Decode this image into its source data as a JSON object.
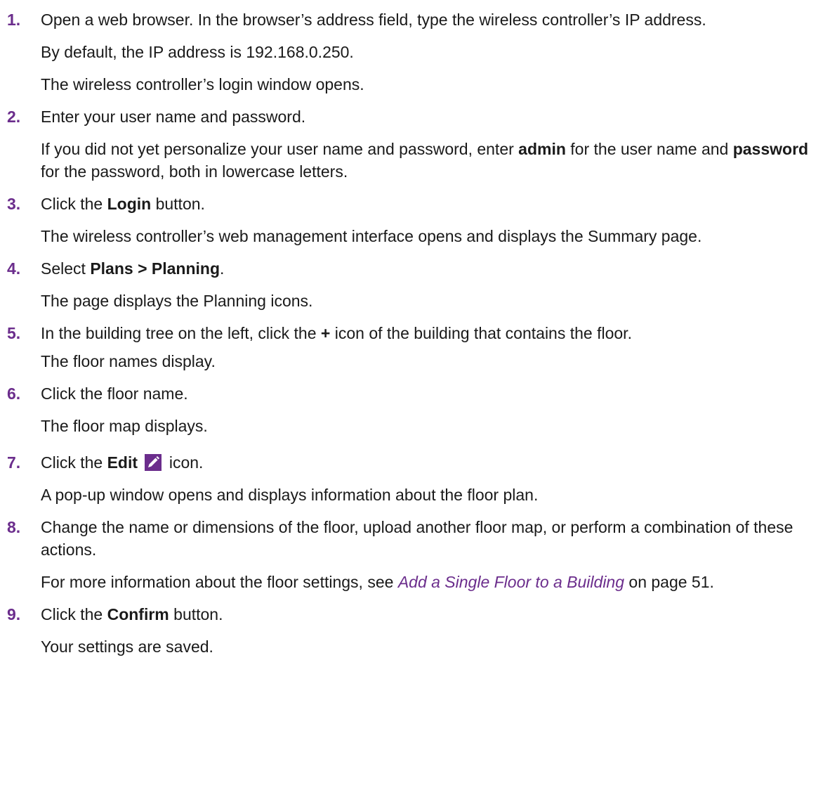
{
  "steps": [
    {
      "num": "1.",
      "main": "Open a web browser. In the browser’s address field, type the wireless controller’s IP address.",
      "subs": [
        "By default, the IP address is 192.168.0.250.",
        "The wireless controller’s login window opens."
      ]
    },
    {
      "num": "2.",
      "main": "Enter your user name and password.",
      "sub1_a": "If you did not yet personalize your user name and password, enter ",
      "sub1_b1": "admin",
      "sub1_c": " for the user name and ",
      "sub1_b2": "password",
      "sub1_d": " for the password, both in lowercase letters."
    },
    {
      "num": "3.",
      "main_a": "Click the ",
      "main_b": "Login",
      "main_c": " button.",
      "sub1": "The wireless controller’s web management interface opens and displays the Summary page."
    },
    {
      "num": "4.",
      "main_a": "Select ",
      "main_b": "Plans > Planning",
      "main_c": ".",
      "sub1": "The page displays the Planning icons."
    },
    {
      "num": "5.",
      "main_a": "In the building tree on the left, click the ",
      "main_b": "+",
      "main_c": " icon of the building that contains the floor.",
      "sub1": "The floor names display."
    },
    {
      "num": "6.",
      "main": "Click the floor name.",
      "sub1": "The floor map displays."
    },
    {
      "num": "7.",
      "main_a": "Click the ",
      "main_b": "Edit",
      "main_c": " icon.",
      "sub1": "A pop-up window opens and displays information about the floor plan."
    },
    {
      "num": "8.",
      "main": "Change the name or dimensions of the floor, upload another floor map, or perform a combination of these actions.",
      "sub1_a": "For more information about the floor settings, see ",
      "sub1_link": "Add a Single Floor to a Building",
      "sub1_b": " on page 51."
    },
    {
      "num": "9.",
      "main_a": "Click the ",
      "main_b": "Confirm",
      "main_c": " button.",
      "sub1": "Your settings are saved."
    }
  ],
  "colors": {
    "accent": "#6b2d8c",
    "text": "#1a1a1a"
  },
  "icons": {
    "edit": "pencil-edit-icon"
  }
}
